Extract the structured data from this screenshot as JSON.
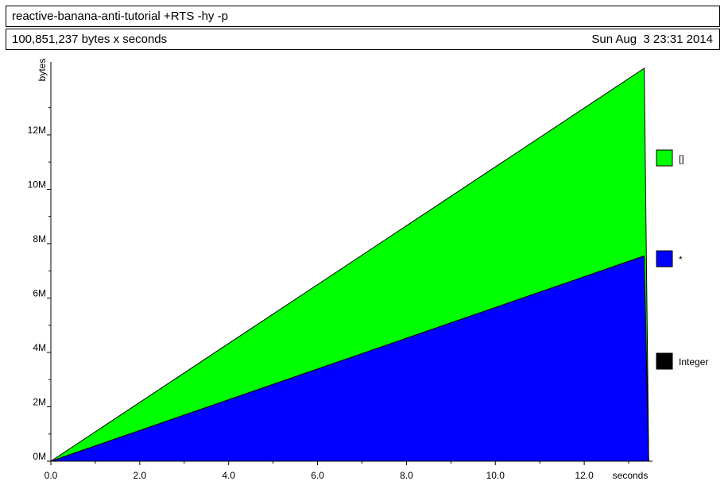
{
  "header": {
    "title": "reactive-banana-anti-tutorial +RTS -hy -p",
    "total": "100,851,237 bytes x seconds",
    "date": "Sun Aug  3 23:31 2014"
  },
  "chart_data": {
    "type": "area",
    "stacked": true,
    "xlabel": "seconds",
    "ylabel": "bytes",
    "xlim": [
      0,
      13.5
    ],
    "ylim": [
      0,
      14800000
    ],
    "x_ticks": [
      "0.0",
      "2.0",
      "4.0",
      "6.0",
      "8.0",
      "10.0",
      "12.0"
    ],
    "x_tick_values": [
      0,
      2,
      4,
      6,
      8,
      10,
      12
    ],
    "y_ticks": [
      "0M",
      "2M",
      "4M",
      "6M",
      "8M",
      "10M",
      "12M"
    ],
    "y_tick_values": [
      0,
      2000000,
      4000000,
      6000000,
      8000000,
      10000000,
      12000000
    ],
    "x": [
      0,
      13.35,
      13.45
    ],
    "series": [
      {
        "name": "Integer",
        "color": "#000000",
        "values": [
          0,
          0,
          0
        ]
      },
      {
        "name": "*",
        "color": "#0000ff",
        "values": [
          0,
          7550000,
          0
        ]
      },
      {
        "name": "[]",
        "color": "#00ff00",
        "values": [
          0,
          6900000,
          0
        ]
      }
    ],
    "legend_position": "right",
    "legend_order": [
      "[]",
      "*",
      "Integer"
    ]
  }
}
